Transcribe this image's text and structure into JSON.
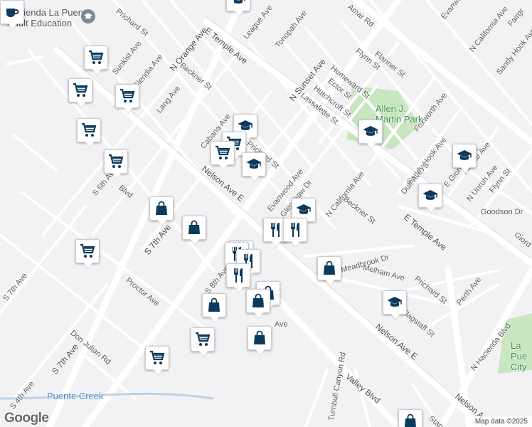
{
  "map": {
    "logo": "Google",
    "attribution": "Map data ©2025",
    "colors": {
      "marker_icon": "#0c3a5c",
      "park": "#c8e6c0",
      "background": "#f2f2f4",
      "road": "#ffffff"
    },
    "places": [
      {
        "id": "school",
        "lines": [
          "Hacienda La Puente",
          "Adult Education"
        ]
      }
    ],
    "parks": [
      {
        "id": "allen",
        "lines": [
          "Allen J.",
          "Martin Park"
        ]
      },
      {
        "id": "lapuente",
        "lines": [
          "La Pue",
          "City"
        ]
      }
    ],
    "water": [
      "Puente Creek"
    ],
    "streets": [
      "Prichard St",
      "League Ave",
      "Tonopah Ave",
      "Amar Rd",
      "Evanwood",
      "Fairgr",
      "Sunkist Ave",
      "Glendia Ave",
      "N Orange Ave",
      "E Temple Ave",
      "Beckner St",
      "Flynn St",
      "Flanner St",
      "N California Ave",
      "Sandy Hook Ave",
      "Homeward St",
      "N Sunset Ave",
      "Ector St",
      "Hutchcroft St",
      "Lassalette St",
      "Lang Ave",
      "Cabana Ave",
      "Foxworth Ave",
      "Prichard St",
      "Nelson Ave E",
      "Evanwood Ave",
      "Glenshaw Dr",
      "N California Ave",
      "Sandy Hook Ave",
      "Duff Ave",
      "S",
      "Beckner St",
      "Allgate Ave",
      "E Giordano St",
      "Flynn St",
      "N Unruh Ave",
      "Goodson Dr",
      "S 6th Ave",
      "S 7th Ave",
      "E Temple Ave",
      "Giord",
      "Meadbrook Dr",
      "Melham Ave",
      "Prichard St",
      "Perth Ave",
      "S 8th Ave",
      "Proctor Ave",
      "Flagstaff St",
      "Nelson Ave E",
      "N Hacienda Blvd",
      "Ave",
      "S 7th Ave",
      "Don Julian Rd",
      "Turnbull Canyon Rd",
      "Valley Blvd",
      "S 7th Ave",
      "S 4th Ave",
      "Blvd",
      "Nelson A",
      "Stan"
    ]
  },
  "markers": [
    {
      "type": "school"
    },
    {
      "type": "shopping-cart"
    },
    {
      "type": "shopping-cart"
    },
    {
      "type": "shopping-cart"
    },
    {
      "type": "shopping-cart"
    },
    {
      "type": "shopping-cart"
    },
    {
      "type": "school"
    },
    {
      "type": "shopping-cart"
    },
    {
      "type": "shopping-cart"
    },
    {
      "type": "school"
    },
    {
      "type": "school"
    },
    {
      "type": "school"
    },
    {
      "type": "school"
    },
    {
      "type": "shopping-bag"
    },
    {
      "type": "school"
    },
    {
      "type": "shopping-bag"
    },
    {
      "type": "restaurant"
    },
    {
      "type": "restaurant"
    },
    {
      "type": "restaurant"
    },
    {
      "type": "restaurant"
    },
    {
      "type": "restaurant"
    },
    {
      "type": "shopping-cart"
    },
    {
      "type": "shopping-bag"
    },
    {
      "type": "restaurant"
    },
    {
      "type": "shopping-bag"
    },
    {
      "type": "shopping-bag"
    },
    {
      "type": "school"
    },
    {
      "type": "shopping-bag"
    },
    {
      "type": "shopping-bag"
    },
    {
      "type": "shopping-cart"
    },
    {
      "type": "shopping-cart"
    },
    {
      "type": "shopping-bag"
    },
    {
      "type": "coffee"
    }
  ]
}
